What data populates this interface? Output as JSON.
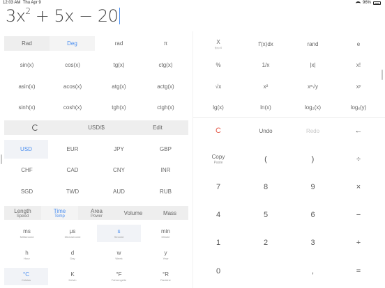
{
  "status": {
    "time": "12:03 AM",
    "date": "Thu Apr 9",
    "battery": "96%"
  },
  "expression": {
    "term1": "3x",
    "exp": "2",
    "rest": " + 5x − 20"
  },
  "angle": {
    "rad": "Rad",
    "deg": "Deg",
    "selected": "Deg"
  },
  "sci_left": [
    [
      "rad",
      "π"
    ],
    [
      "sin(x)",
      "cos(x)",
      "tg(x)",
      "ctg(x)"
    ],
    [
      "asin(x)",
      "acos(x)",
      "atg(x)",
      "actg(x)"
    ],
    [
      "sinh(x)",
      "cosh(x)",
      "tgh(x)",
      "ctgh(x)"
    ]
  ],
  "sci_right": [
    [
      {
        "main": "X",
        "sub": "f(x)=0"
      },
      {
        "main": "f'(x)dx",
        "sub": ""
      },
      {
        "main": "rand",
        "sub": ""
      },
      {
        "main": "e",
        "sub": ""
      }
    ],
    [
      {
        "main": "%"
      },
      {
        "main": "1/x"
      },
      {
        "main": "|x|"
      },
      {
        "main": "x!"
      }
    ],
    [
      {
        "main": "√x"
      },
      {
        "main": "x²"
      },
      {
        "main": "xˣ√y"
      },
      {
        "main": "xʸ"
      }
    ],
    [
      {
        "main": "lg(x)"
      },
      {
        "main": "ln(x)"
      },
      {
        "main": "log₂(x)"
      },
      {
        "main": "logₓ(y)"
      }
    ]
  ],
  "converter_bar": {
    "refresh_icon": "refresh-icon",
    "title": "USD/$",
    "edit": "Edit"
  },
  "currencies": [
    [
      "USD",
      "EUR",
      "JPY",
      "GBP"
    ],
    [
      "CHF",
      "CAD",
      "CNY",
      "INR"
    ],
    [
      "SGD",
      "TWD",
      "AUD",
      "RUB"
    ]
  ],
  "selected_currency": "USD",
  "unit_tabs": [
    {
      "main": "Length",
      "sub": "Speed"
    },
    {
      "main": "Time",
      "sub": "Temp"
    },
    {
      "main": "Area",
      "sub": "Power"
    },
    {
      "main": "Volume",
      "sub": ""
    },
    {
      "main": "Mass",
      "sub": ""
    }
  ],
  "units_time": [
    {
      "main": "ms",
      "sub": "Millisecond"
    },
    {
      "main": "μs",
      "sub": "Microsecond"
    },
    {
      "main": "s",
      "sub": "Second"
    },
    {
      "main": "min",
      "sub": "Minute"
    }
  ],
  "units_time2": [
    {
      "main": "h",
      "sub": "Hour"
    },
    {
      "main": "d",
      "sub": "Day"
    },
    {
      "main": "w",
      "sub": "Week"
    },
    {
      "main": "y",
      "sub": "Year"
    }
  ],
  "units_temp": [
    {
      "main": "°C",
      "sub": "Celsius"
    },
    {
      "main": "K",
      "sub": "Kelvin"
    },
    {
      "main": "°F",
      "sub": "Fahrengeite"
    },
    {
      "main": "°R",
      "sub": "Rankine"
    }
  ],
  "control_row": {
    "clear": "C",
    "undo": "Undo",
    "redo": "Redo",
    "back": "←"
  },
  "copy": {
    "main": "Copy",
    "sub": "Paste"
  },
  "pad": [
    [
      "(",
      ")",
      "÷"
    ],
    [
      "7",
      "8",
      "9",
      "×"
    ],
    [
      "4",
      "5",
      "6",
      "−"
    ],
    [
      "1",
      "2",
      "3",
      "+"
    ],
    [
      "0",
      "",
      ",",
      "="
    ]
  ],
  "colors": {
    "accent": "#4a8ef0",
    "clear": "#e45b4b"
  }
}
